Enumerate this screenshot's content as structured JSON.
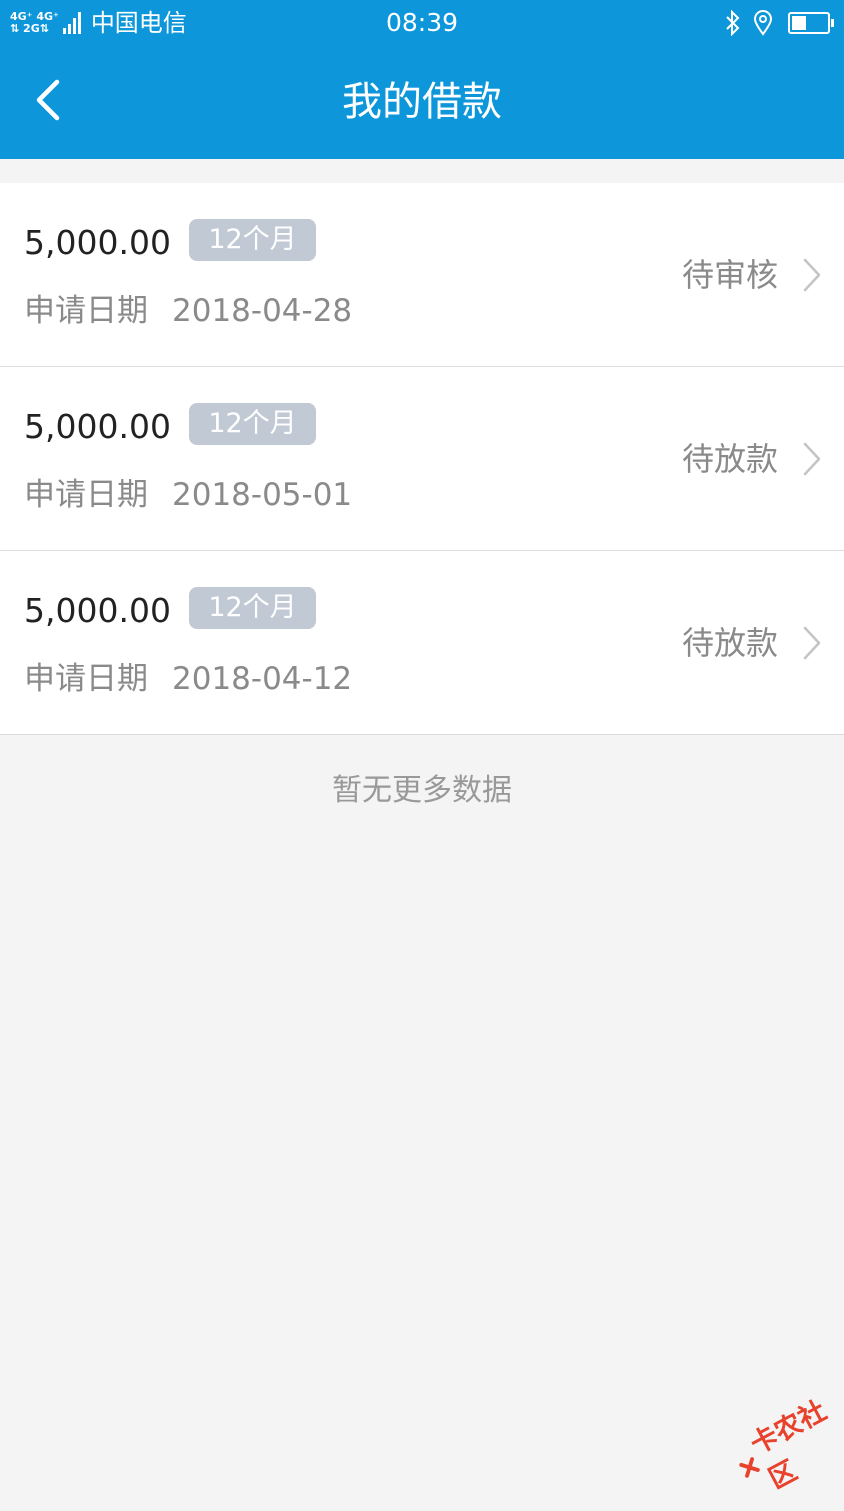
{
  "status_bar": {
    "network_top": "4G⁺ 4G⁺",
    "network_bottom": "⇅ 2G⇅",
    "carrier": "中国电信",
    "time": "08:39"
  },
  "header": {
    "title": "我的借款"
  },
  "loans": [
    {
      "amount": "5,000.00",
      "term": "12个月",
      "date_label": "申请日期",
      "date": "2018-04-28",
      "status": "待审核"
    },
    {
      "amount": "5,000.00",
      "term": "12个月",
      "date_label": "申请日期",
      "date": "2018-05-01",
      "status": "待放款"
    },
    {
      "amount": "5,000.00",
      "term": "12个月",
      "date_label": "申请日期",
      "date": "2018-04-12",
      "status": "待放款"
    }
  ],
  "empty_text": "暂无更多数据",
  "watermark": "卡农社区",
  "colors": {
    "header_bg": "#0d97da",
    "tag_bg": "#c1c9d4",
    "page_bg": "#f4f4f4",
    "watermark": "#e8412c"
  },
  "battery_level": 0.4
}
